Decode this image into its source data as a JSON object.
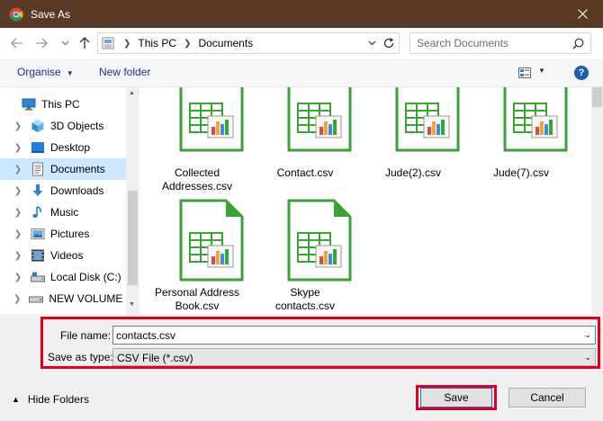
{
  "window": {
    "title": "Save As"
  },
  "address": {
    "crumbs": [
      "This PC",
      "Documents"
    ],
    "search_placeholder": "Search Documents"
  },
  "toolbar": {
    "organise_label": "Organise",
    "new_folder_label": "New folder",
    "help_label": "?"
  },
  "nav": {
    "root_label": "This PC",
    "items": [
      {
        "label": "3D Objects",
        "icon": "3d-objects-icon"
      },
      {
        "label": "Desktop",
        "icon": "desktop-icon"
      },
      {
        "label": "Documents",
        "icon": "documents-icon",
        "selected": true
      },
      {
        "label": "Downloads",
        "icon": "downloads-icon"
      },
      {
        "label": "Music",
        "icon": "music-icon"
      },
      {
        "label": "Pictures",
        "icon": "pictures-icon"
      },
      {
        "label": "Videos",
        "icon": "videos-icon"
      },
      {
        "label": "Local Disk (C:)",
        "icon": "local-disk-icon"
      },
      {
        "label": "NEW VOLUME (E",
        "icon": "drive-icon"
      }
    ]
  },
  "files": [
    {
      "line1": "Collected",
      "line2": "Addresses.csv"
    },
    {
      "line1": "Contact.csv",
      "line2": ""
    },
    {
      "line1": "Jude(2).csv",
      "line2": ""
    },
    {
      "line1": "Jude(7).csv",
      "line2": ""
    },
    {
      "line1": "Personal Address",
      "line2": "Book.csv"
    },
    {
      "line1": "Skype",
      "line2": "contacts.csv"
    }
  ],
  "form": {
    "file_name_label": "File name:",
    "file_name_value": "contacts.csv",
    "save_type_label": "Save as type:",
    "save_type_value": "CSV File (*.csv)"
  },
  "footer": {
    "hide_folders_label": "Hide Folders",
    "save_label": "Save",
    "cancel_label": "Cancel"
  },
  "colors": {
    "title_bar": "#5a3a25",
    "highlight_box": "#e0001b",
    "selected_nav": "#cce8ff",
    "doc_green": "#3aa335"
  }
}
